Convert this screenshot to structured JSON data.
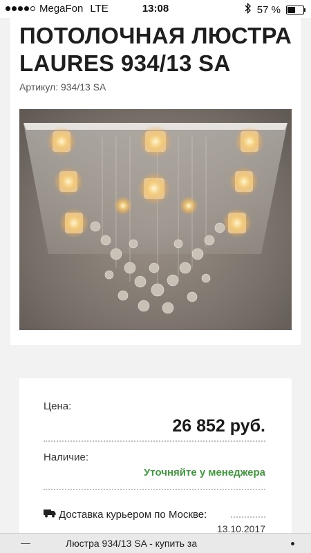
{
  "status_bar": {
    "carrier": "MegaFon",
    "network": "LTE",
    "time": "13:08",
    "battery_text": "57 %",
    "battery_level": 0.57,
    "signal_bars_filled": 4,
    "signal_bars_total": 5,
    "icons": [
      "bluetooth-icon",
      "battery-icon"
    ]
  },
  "product": {
    "title": "ПОТОЛОЧНАЯ ЛЮСТРА LAURES 934/13 SA",
    "sku_text": "Артикул: 934/13 SA"
  },
  "price_card": {
    "price_label": "Цена:",
    "price_value": "26 852 руб.",
    "availability_label": "Наличие:",
    "availability_value": "Уточняйте у менеджера",
    "availability_color": "#3f9a3c",
    "delivery_icon": "truck-icon",
    "delivery_label": "Доставка курьером по Москве:",
    "delivery_date": "13.10.2017"
  },
  "bottom_bar": {
    "page_title": "Люстра 934/13 SA - купить за"
  }
}
